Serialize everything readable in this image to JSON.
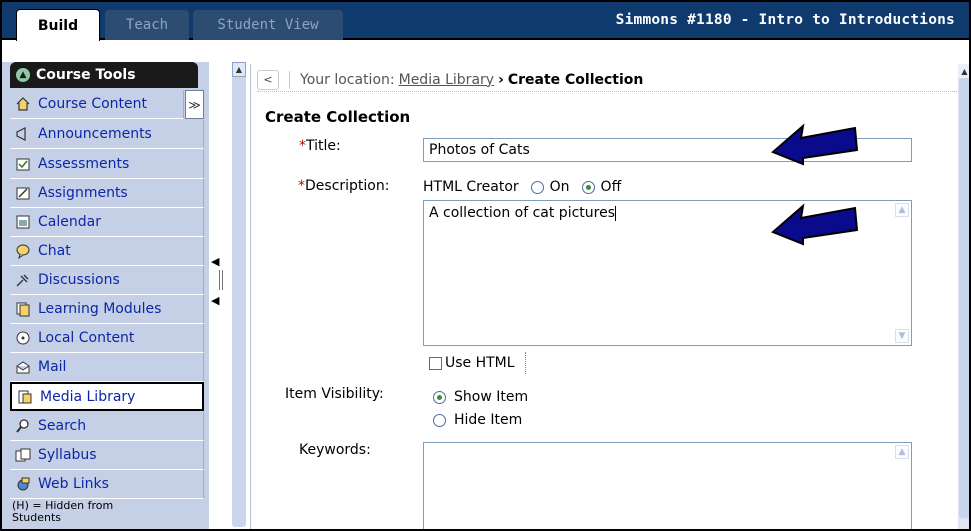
{
  "topbar": {
    "tabs": [
      {
        "label": "Build",
        "active": true
      },
      {
        "label": "Teach",
        "active": false
      },
      {
        "label": "Student View",
        "active": false
      }
    ],
    "course_title": "Simmons #1180 - Intro to Introductions"
  },
  "sidebar": {
    "header": "Course Tools",
    "items": [
      {
        "label": "Course Content",
        "icon": "home-icon"
      },
      {
        "label": "Announcements",
        "icon": "megaphone-icon"
      },
      {
        "label": "Assessments",
        "icon": "assessments-icon"
      },
      {
        "label": "Assignments",
        "icon": "assignments-icon"
      },
      {
        "label": "Calendar",
        "icon": "calendar-icon"
      },
      {
        "label": "Chat",
        "icon": "chat-icon"
      },
      {
        "label": "Discussions",
        "icon": "pin-icon"
      },
      {
        "label": "Learning Modules",
        "icon": "modules-icon"
      },
      {
        "label": "Local Content",
        "icon": "cd-icon"
      },
      {
        "label": "Mail",
        "icon": "mail-icon"
      },
      {
        "label": "Media Library",
        "icon": "media-icon",
        "active": true
      },
      {
        "label": "Search",
        "icon": "magnifier-icon"
      },
      {
        "label": "Syllabus",
        "icon": "syllabus-icon"
      },
      {
        "label": "Web Links",
        "icon": "globe-icon"
      }
    ],
    "hidden_note_line1": "(H) = Hidden from",
    "hidden_note_line2": "Students"
  },
  "breadcrumb": {
    "prefix": "Your location:",
    "link": "Media Library",
    "separator": "›",
    "current": "Create Collection"
  },
  "form": {
    "section_title": "Create Collection",
    "title_label": "Title:",
    "title_value": "Photos of Cats",
    "description_label": "Description:",
    "html_creator_label": "HTML Creator",
    "html_on": "On",
    "html_off": "Off",
    "html_selected": "Off",
    "description_value": "A collection of cat pictures",
    "use_html_label": "Use HTML",
    "use_html_checked": false,
    "visibility_label": "Item Visibility:",
    "visibility_show": "Show Item",
    "visibility_hide": "Hide Item",
    "visibility_selected": "Show Item",
    "keywords_label": "Keywords:",
    "required_marker": "*"
  },
  "annotations": {
    "arrow_color": "#0a0a8c"
  }
}
